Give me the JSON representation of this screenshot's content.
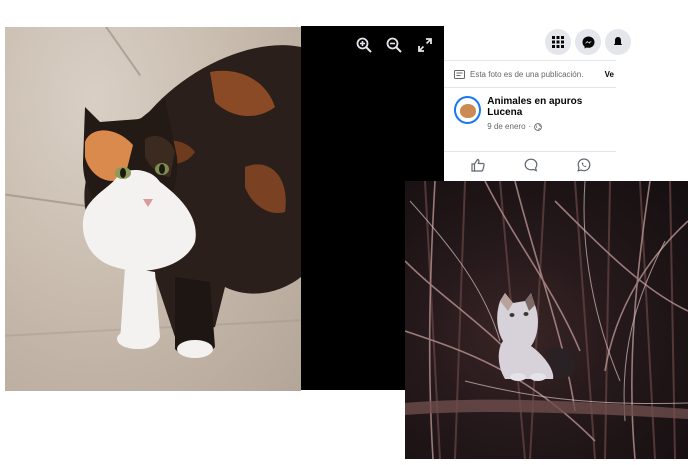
{
  "viewer": {
    "zoom_in_icon": "zoom-in-icon",
    "zoom_out_icon": "zoom-out-icon",
    "fullscreen_icon": "fullscreen-icon"
  },
  "facebook": {
    "info_text": "Esta foto es de una publicación.",
    "info_link": "Ve",
    "page_name": "Animales en apuros Lucena",
    "post_date": "9 de enero",
    "separator": "·",
    "accent_color": "#1877f2"
  }
}
